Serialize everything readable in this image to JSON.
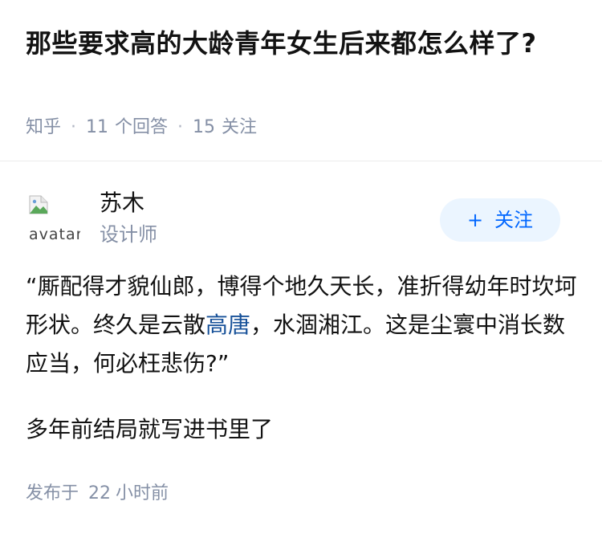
{
  "question": {
    "title": "那些要求高的大龄青年女生后来都怎么样了?",
    "source": "知乎",
    "answer_count": "11",
    "answer_label": "个回答",
    "follower_count": "15",
    "follower_label": "关注"
  },
  "answer": {
    "author": {
      "avatar_alt": "avatar",
      "name": "苏木",
      "headline": "设计师"
    },
    "follow_button": {
      "icon": "plus-icon",
      "label": "关注"
    },
    "content": {
      "paragraph1_before_link": "“厮配得才貌仙郎，博得个地久天长，准折得幼年时坎坷形状。终久是云散",
      "paragraph1_link": "高唐",
      "paragraph1_after_link": "，水涸湘江。这是尘寰中消长数应当，何必枉悲伤?”",
      "paragraph2": "多年前结局就写进书里了"
    },
    "publish": {
      "prefix": "发布于",
      "number": "22",
      "unit": "小时前"
    }
  },
  "colors": {
    "meta_gray": "#8590a6",
    "brand_blue": "#0066ff",
    "follow_bg": "#ebf5ff",
    "link_blue": "#175199"
  }
}
